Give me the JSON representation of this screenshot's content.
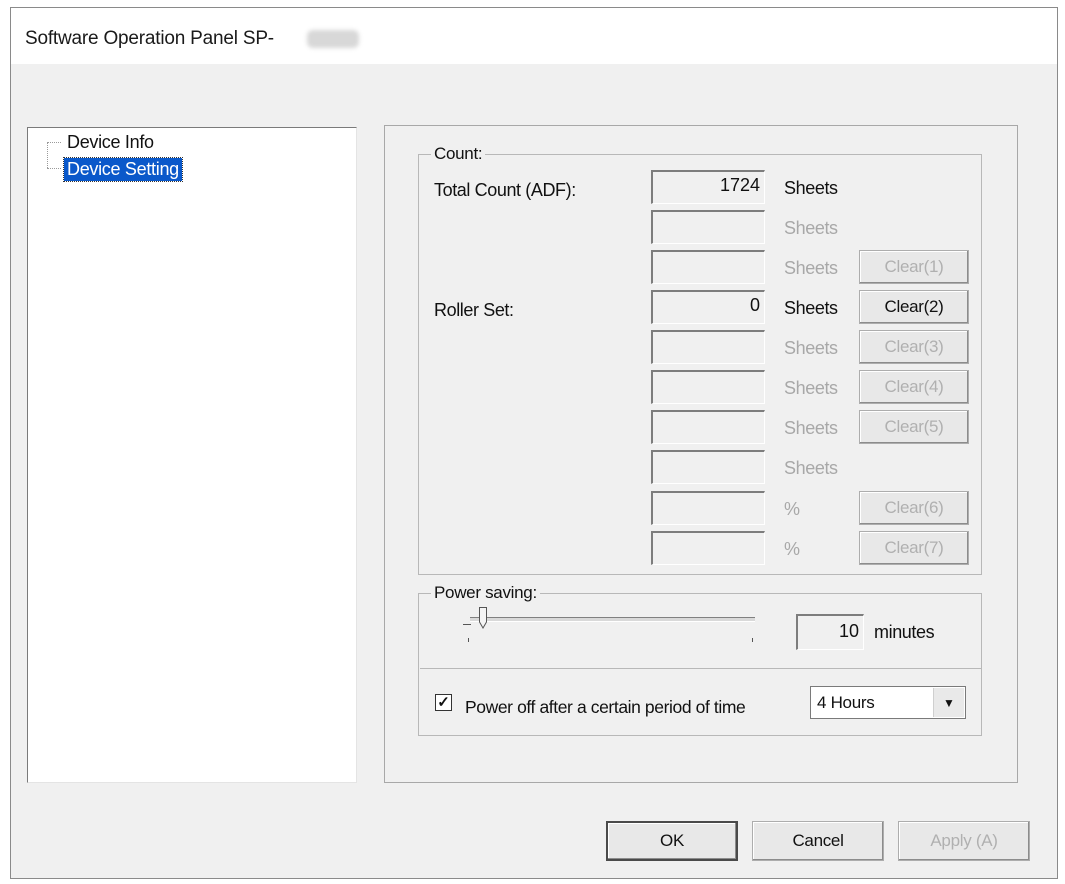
{
  "window": {
    "title": "Software Operation Panel SP-"
  },
  "tree": {
    "items": [
      {
        "label": "Device Info"
      },
      {
        "label": "Device Setting"
      }
    ]
  },
  "count": {
    "group_label": "Count:",
    "total_label": "Total Count (ADF):",
    "roller_label": "Roller Set:",
    "rows": [
      {
        "value": "1724",
        "unit": "Sheets",
        "button": ""
      },
      {
        "value": "",
        "unit": "Sheets",
        "button": ""
      },
      {
        "value": "",
        "unit": "Sheets",
        "button": "Clear(1)"
      },
      {
        "value": "0",
        "unit": "Sheets",
        "button": "Clear(2)"
      },
      {
        "value": "",
        "unit": "Sheets",
        "button": "Clear(3)"
      },
      {
        "value": "",
        "unit": "Sheets",
        "button": "Clear(4)"
      },
      {
        "value": "",
        "unit": "Sheets",
        "button": "Clear(5)"
      },
      {
        "value": "",
        "unit": "Sheets",
        "button": ""
      },
      {
        "value": "",
        "unit": "%",
        "button": "Clear(6)"
      },
      {
        "value": "",
        "unit": "%",
        "button": "Clear(7)"
      }
    ]
  },
  "power": {
    "group_label": "Power saving:",
    "minutes_value": "10",
    "minutes_unit": "minutes",
    "slider_level_fraction": 0.03,
    "poweroff_checked": true,
    "poweroff_check_glyph": "✓",
    "poweroff_label": "Power off after a certain period of time",
    "poweroff_selected": "4 Hours"
  },
  "footer": {
    "ok": "OK",
    "cancel": "Cancel",
    "apply": "Apply (A)"
  }
}
